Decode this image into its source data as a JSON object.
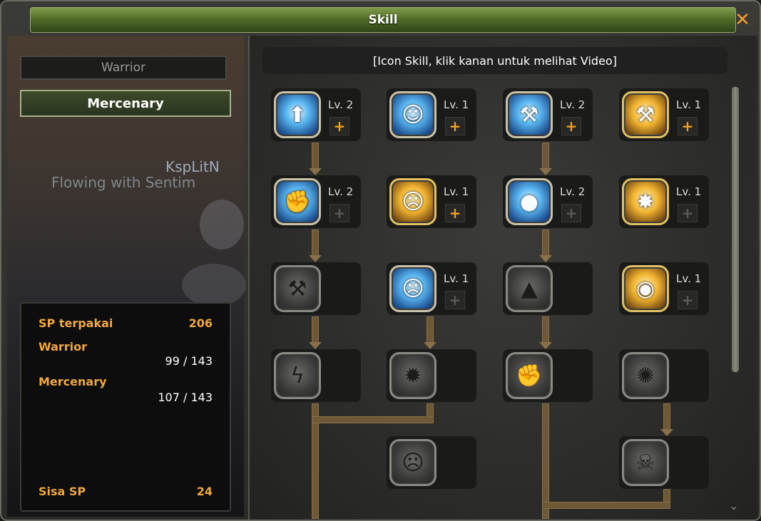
{
  "window": {
    "title": "Skill",
    "close_label": "✕"
  },
  "tabs": {
    "warrior": "Warrior",
    "mercenary": "Mercenary"
  },
  "scene": {
    "text1": "KspLitN",
    "text2": "Flowing with Sentim"
  },
  "sp": {
    "used_label": "SP terpakai",
    "used_value": "206",
    "warrior_label": "Warrior",
    "warrior_value": "99 / 143",
    "mercenary_label": "Mercenary",
    "mercenary_value": "107 / 143",
    "remaining_label": "Sisa SP",
    "remaining_value": "24"
  },
  "hint": "[Icon Skill, klik kanan untuk melihat Video]",
  "skills": {
    "r1c1": {
      "level": "Lv. 2",
      "plus": "+",
      "icon": "stomp-icon"
    },
    "r1c2": {
      "level": "Lv. 1",
      "plus": "+",
      "icon": "roar-icon"
    },
    "r1c3": {
      "level": "Lv. 2",
      "plus": "+",
      "icon": "axe-icon"
    },
    "r1c4": {
      "level": "Lv. 1",
      "plus": "+",
      "icon": "hammer-strike-icon"
    },
    "r2c1": {
      "level": "Lv. 2",
      "plus": "+",
      "icon": "punch-icon"
    },
    "r2c2": {
      "level": "Lv. 1",
      "plus": "+",
      "icon": "shout-icon"
    },
    "r2c3": {
      "level": "Lv. 2",
      "plus": "+",
      "icon": "bomb-icon"
    },
    "r2c4": {
      "level": "Lv. 1",
      "plus": "+",
      "icon": "ground-smash-icon"
    },
    "r3c2": {
      "level": "Lv. 1",
      "plus": "+",
      "icon": "rage-face-icon"
    },
    "r3c4": {
      "level": "Lv. 1",
      "plus": "+",
      "icon": "golden-aura-icon"
    }
  }
}
